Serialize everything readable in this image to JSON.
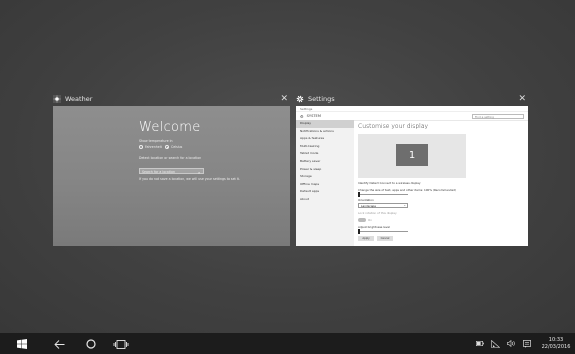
{
  "weather": {
    "title": "Weather",
    "welcome": "Welcome",
    "line1": "Show temperature in",
    "option_f": "Fahrenheit",
    "option_c": "Celsius",
    "line2": "Detect location or search for a location",
    "search_placeholder": "Search for a location",
    "footer": "If you do not save a location, we will use your settings to set it."
  },
  "settings": {
    "title": "Settings",
    "window_label": "Settings",
    "header_label": "SYSTEM",
    "search_placeholder": "Find a setting",
    "sidebar": [
      "Display",
      "Notifications & actions",
      "Apps & features",
      "Multi-tasking",
      "Tablet mode",
      "Battery saver",
      "Power & sleep",
      "Storage",
      "Offline maps",
      "Default apps",
      "About"
    ],
    "heading": "Customise your display",
    "monitor_number": "1",
    "links": "Identify    Detect    Connect to a wireless display",
    "scale_text": "Change the size of text, apps and other items: 100% (Recommended)",
    "orientation_label": "Orientation",
    "orientation_value": "Landscape",
    "lock_rotation": "Lock rotation of this display",
    "toggle_state": "On",
    "brightness_label": "Adjust brightness level",
    "apply": "Apply",
    "cancel": "Cancel"
  },
  "taskbar": {
    "time": "10:33",
    "date": "22/03/2016"
  }
}
